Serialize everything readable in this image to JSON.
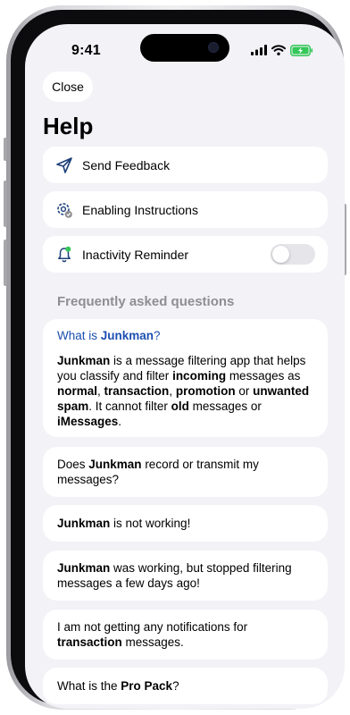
{
  "status_bar": {
    "time": "9:41"
  },
  "close_label": "Close",
  "page_title": "Help",
  "menu": {
    "send_feedback": "Send Feedback",
    "enabling_instructions": "Enabling Instructions",
    "inactivity_reminder": "Inactivity Reminder",
    "inactivity_reminder_enabled": false
  },
  "faq": {
    "heading": "Frequently asked questions",
    "q1": {
      "pre": "What is ",
      "bold": "Junkman",
      "post": "?"
    },
    "a1": {
      "p1": "Junkman",
      "t1": " is a message filtering app that helps you classify and filter ",
      "p2": "incoming",
      "t2": " messages as ",
      "p3": "normal",
      "t3": ", ",
      "p4": "transaction",
      "t4": ", ",
      "p5": "promotion",
      "t5": " or ",
      "p6": "unwanted spam",
      "t6": ". It cannot filter ",
      "p7": "old",
      "t7": " messages or ",
      "p8": "iMessages",
      "t8": "."
    },
    "q2": {
      "pre": "Does ",
      "bold": "Junkman",
      "post": " record or transmit my messages?"
    },
    "q3": {
      "bold": "Junkman",
      "post": " is not working!"
    },
    "q4": {
      "bold": "Junkman",
      "post": " was working, but stopped filtering messages a few days ago!"
    },
    "q5": {
      "pre": "I am not getting any notifications for ",
      "bold": "transaction",
      "post": " messages."
    },
    "q6": {
      "pre": "What is the ",
      "bold": "Pro Pack",
      "post": "?"
    }
  },
  "colors": {
    "accent_blue": "#1c4fb0",
    "background": "#f2f2f7",
    "battery_green": "#34c759"
  },
  "icons": [
    "paper-plane-icon",
    "gear-check-icon",
    "bell-icon",
    "signal-icon",
    "wifi-icon",
    "battery-icon"
  ]
}
